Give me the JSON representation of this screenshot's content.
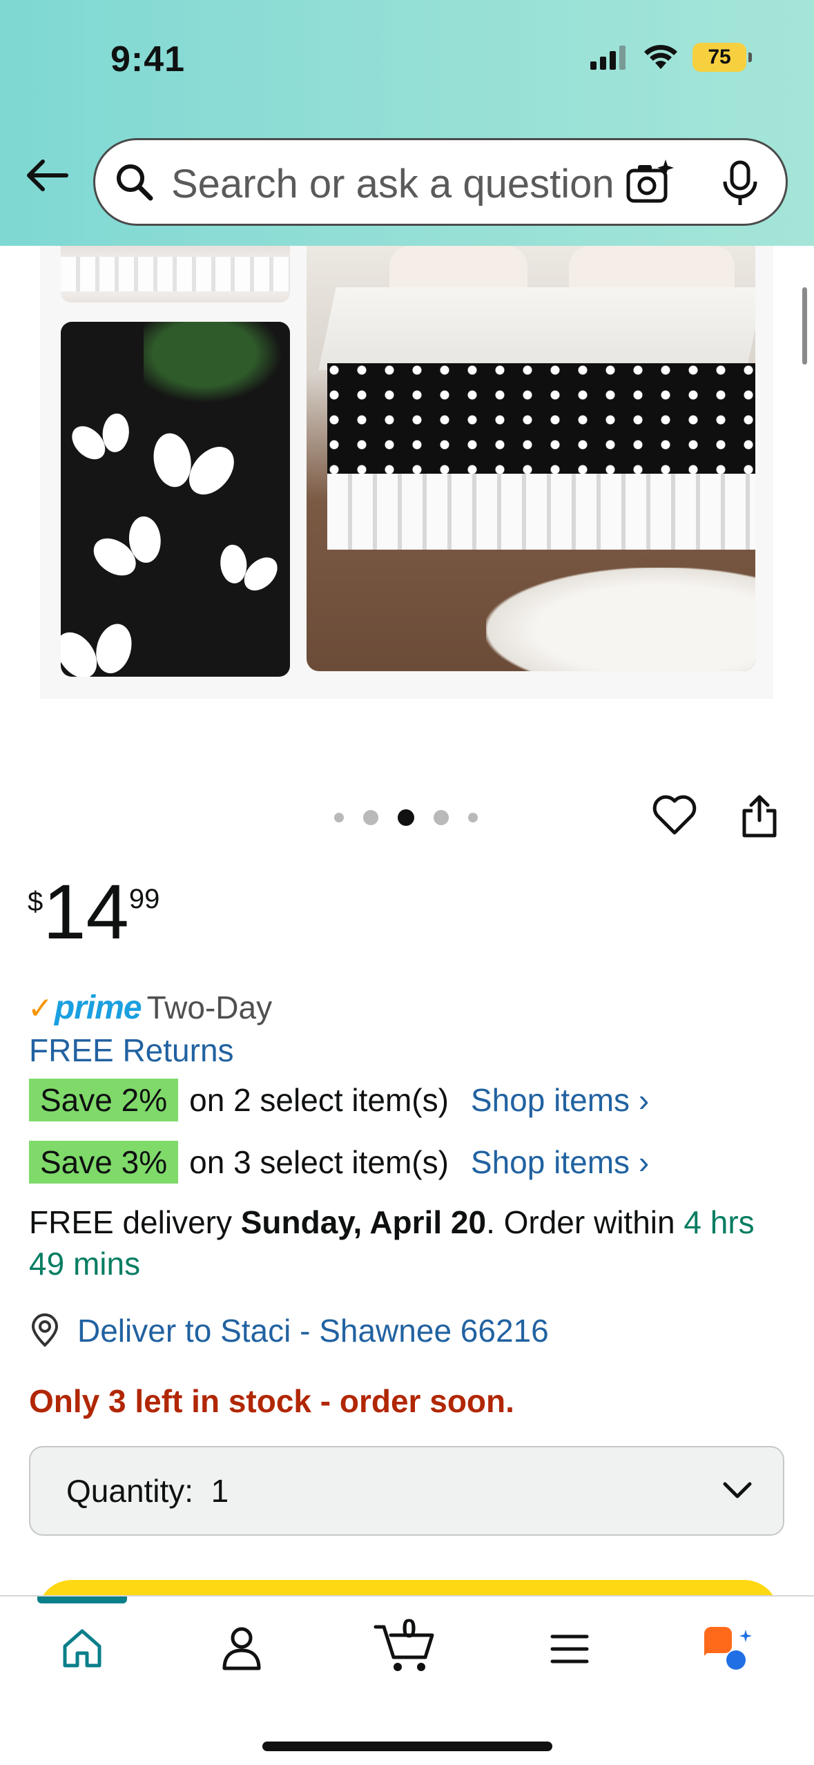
{
  "status_bar": {
    "time": "9:41",
    "battery": "75"
  },
  "search": {
    "placeholder": "Search or ask a question"
  },
  "carousel": {
    "total_dots": 5,
    "active_index": 2
  },
  "price": {
    "currency": "$",
    "whole": "14",
    "cents": "99"
  },
  "prime": {
    "check": "✓",
    "label": "prime",
    "shipping": "Two-Day"
  },
  "free_returns": "FREE Returns",
  "promotions": [
    {
      "badge": "Save 2%",
      "text": "on 2 select item(s)",
      "link": "Shop items ›"
    },
    {
      "badge": "Save 3%",
      "text": "on 3 select item(s)",
      "link": "Shop items ›"
    }
  ],
  "delivery": {
    "prefix": "FREE delivery ",
    "date": "Sunday, April 20",
    "middle": ". Order within ",
    "countdown": "4 hrs 49 mins"
  },
  "deliver_to": "Deliver to Staci - Shawnee 66216",
  "stock": "Only 3 left in stock - order soon.",
  "quantity": {
    "label": "Quantity:",
    "value": "1"
  },
  "cart": {
    "count": "0"
  },
  "colors": {
    "link": "#2162a1",
    "stock": "#b12704",
    "save_badge": "#7fda6a",
    "accent": "#0a7f8a",
    "buy_button": "#ffd814"
  }
}
